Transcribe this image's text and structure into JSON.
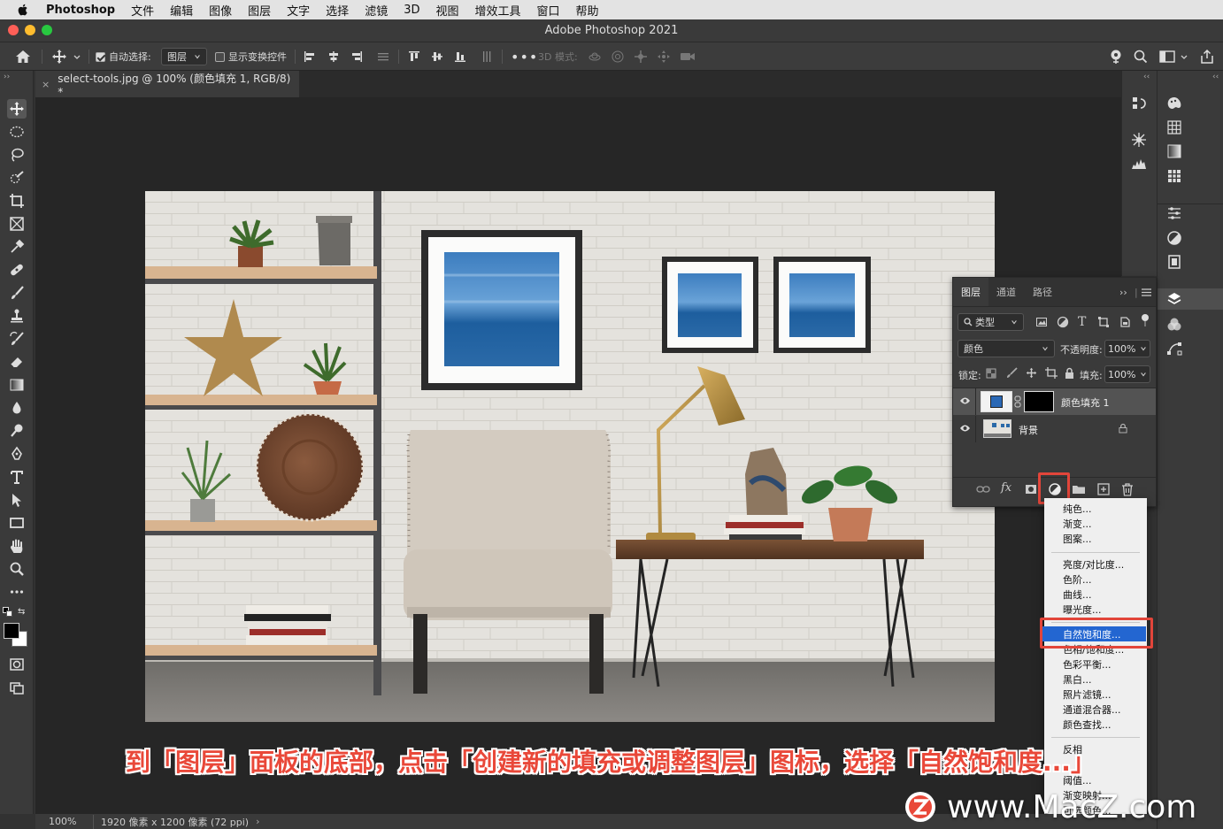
{
  "menubar": {
    "app": "Photoshop",
    "items": [
      "文件",
      "编辑",
      "图像",
      "图层",
      "文字",
      "选择",
      "滤镜",
      "3D",
      "视图",
      "增效工具",
      "窗口",
      "帮助"
    ]
  },
  "window": {
    "title": "Adobe Photoshop 2021"
  },
  "options_bar": {
    "auto_select_label": "自动选择:",
    "auto_select_target": "图层",
    "show_transform_label": "显示变换控件",
    "mode_3d_label": "3D 模式:"
  },
  "document_tab": {
    "label": "select-tools.jpg @ 100% (颜色填充 1, RGB/8) *"
  },
  "layers_panel": {
    "tabs": [
      "图层",
      "通道",
      "路径"
    ],
    "filter_label": "类型",
    "blend_mode": "颜色",
    "opacity_label": "不透明度:",
    "opacity_value": "100%",
    "lock_label": "锁定:",
    "fill_label": "填充:",
    "fill_value": "100%",
    "layers": [
      {
        "name": "颜色填充 1",
        "fill_color": "#2a68b5"
      },
      {
        "name": "背景"
      }
    ]
  },
  "adjustment_menu": {
    "group1": [
      "纯色...",
      "渐变...",
      "图案..."
    ],
    "group2": [
      "亮度/对比度...",
      "色阶...",
      "曲线...",
      "曝光度..."
    ],
    "group3": [
      "自然饱和度...",
      "色相/饱和度...",
      "色彩平衡...",
      "黑白...",
      "照片滤镜...",
      "通道混合器...",
      "颜色查找..."
    ],
    "group4": [
      "反相",
      "阈值...",
      "渐变映射...",
      "可选颜色..."
    ],
    "highlighted": "自然饱和度..."
  },
  "caption": "到「图层」面板的底部，点击「创建新的填充或调整图层」图标，选择「自然饱和度...」",
  "status_bar": {
    "zoom": "100%",
    "doc_info": "1920 像素 x 1200 像素 (72 ppi)"
  },
  "watermark": "www.MacZ.com",
  "colors": {
    "accent_red": "#e2453a",
    "menu_highlight": "#2366d1"
  }
}
